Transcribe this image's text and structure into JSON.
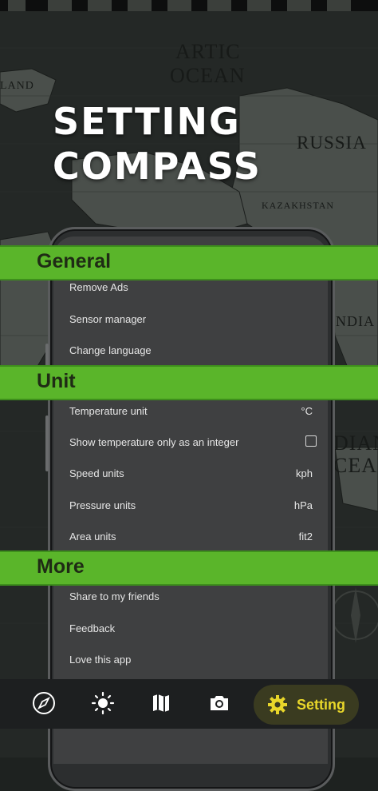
{
  "promo": {
    "line1": "SETTING",
    "line2": "COMPASS"
  },
  "map_labels": {
    "artic": "ARTIC",
    "ocean": "OCEAN",
    "russia": "RUSSIA",
    "kazakhstan": "KAZAKHSTAN",
    "india": "INDIA",
    "indian": "DIAN",
    "indian_ocean": "CEAN",
    "iland": "LAND"
  },
  "sections": {
    "general": {
      "title": "General",
      "items": [
        "Remove Ads",
        "Sensor manager",
        "Change language"
      ]
    },
    "unit": {
      "title": "Unit",
      "items": [
        {
          "label": "Temperature unit",
          "value": "°C"
        },
        {
          "label": "Show temperature only as an integer",
          "checked": false
        },
        {
          "label": "Speed units",
          "value": "kph"
        },
        {
          "label": "Pressure units",
          "value": "hPa"
        },
        {
          "label": "Area units",
          "value": "fit2"
        }
      ]
    },
    "more": {
      "title": "More",
      "items": [
        "Share to my friends",
        "Feedback",
        "Love this app"
      ]
    }
  },
  "bottom_nav": {
    "items": [
      {
        "icon": "compass-icon"
      },
      {
        "icon": "brightness-icon"
      },
      {
        "icon": "map-icon"
      },
      {
        "icon": "camera-icon"
      }
    ],
    "active": {
      "icon": "gear-icon",
      "label": "Setting"
    }
  },
  "colors": {
    "band_green": "#5ab52a",
    "accent_yellow": "#e8d62a",
    "screen_bg": "#3f4041"
  }
}
